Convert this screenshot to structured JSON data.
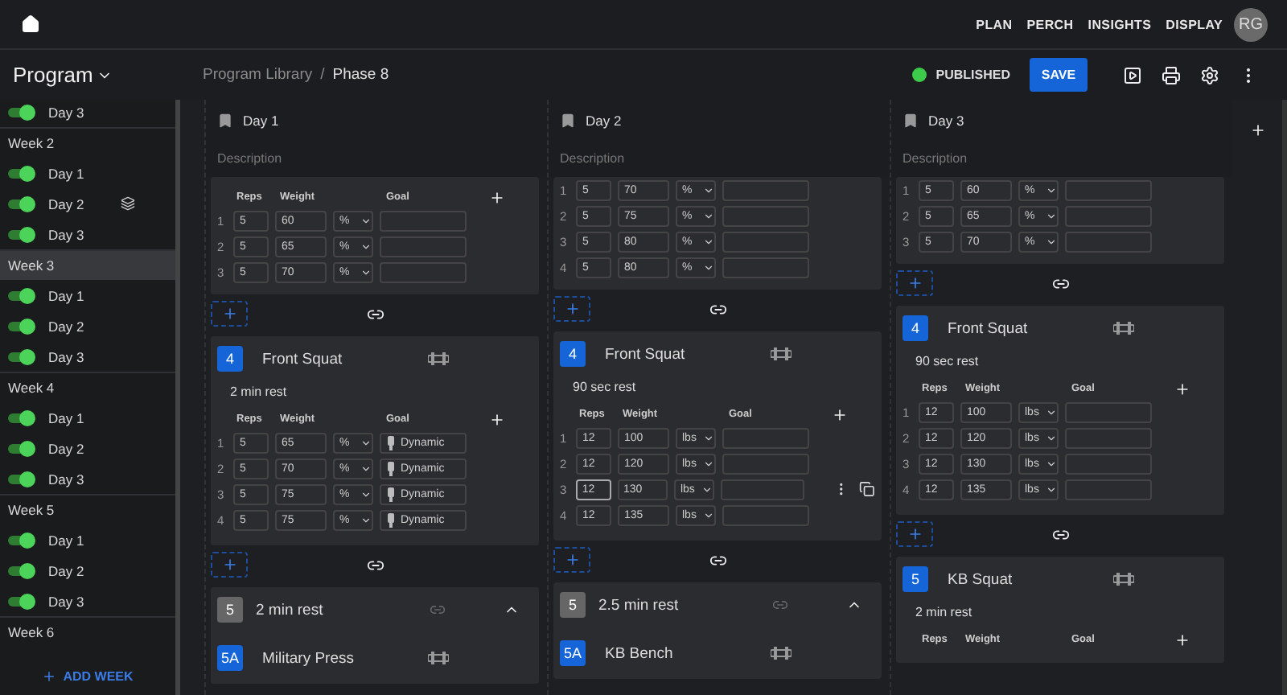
{
  "nav": {
    "links": [
      "PLAN",
      "PERCH",
      "INSIGHTS",
      "DISPLAY"
    ],
    "avatar": "RG"
  },
  "toolbar": {
    "program": "Program",
    "breadcrumb": [
      "Program Library",
      "Phase 8"
    ],
    "separator": "/",
    "status": "PUBLISHED",
    "published": true,
    "save": "SAVE"
  },
  "sidebar": {
    "items": [
      {
        "kind": "day",
        "label": "Day 3",
        "on": true
      },
      {
        "kind": "week",
        "label": "Week 2",
        "selected": false
      },
      {
        "kind": "day",
        "label": "Day 1",
        "on": true
      },
      {
        "kind": "day",
        "label": "Day 2",
        "on": true,
        "layered": true
      },
      {
        "kind": "day",
        "label": "Day 3",
        "on": true
      },
      {
        "kind": "week",
        "label": "Week 3",
        "selected": true
      },
      {
        "kind": "day",
        "label": "Day 1",
        "on": true
      },
      {
        "kind": "day",
        "label": "Day 2",
        "on": true
      },
      {
        "kind": "day",
        "label": "Day 3",
        "on": true
      },
      {
        "kind": "week",
        "label": "Week 4",
        "selected": false
      },
      {
        "kind": "day",
        "label": "Day 1",
        "on": true
      },
      {
        "kind": "day",
        "label": "Day 2",
        "on": true
      },
      {
        "kind": "day",
        "label": "Day 3",
        "on": true
      },
      {
        "kind": "week",
        "label": "Week 5",
        "selected": false
      },
      {
        "kind": "day",
        "label": "Day 1",
        "on": true
      },
      {
        "kind": "day",
        "label": "Day 2",
        "on": true
      },
      {
        "kind": "day",
        "label": "Day 3",
        "on": true
      },
      {
        "kind": "week",
        "label": "Week 6",
        "selected": false
      }
    ],
    "add_week": "ADD WEEK"
  },
  "days": [
    {
      "title": "Day 1",
      "placeholder": "Description",
      "blocks": [
        {
          "kind": "exercise",
          "headers": [
            "Reps",
            "Weight",
            "Goal"
          ],
          "sets": [
            {
              "num": "1",
              "reps": "5",
              "weight": "60",
              "unit": "%"
            },
            {
              "num": "2",
              "reps": "5",
              "weight": "65",
              "unit": "%"
            },
            {
              "num": "3",
              "reps": "5",
              "weight": "70",
              "unit": "%"
            }
          ]
        },
        {
          "kind": "exercise",
          "badge": "4",
          "name": "Front Squat",
          "rest": "2 min rest",
          "headers": [
            "Reps",
            "Weight",
            "Goal"
          ],
          "sets": [
            {
              "num": "1",
              "reps": "5",
              "weight": "65",
              "unit": "%",
              "goal": "Dynamic"
            },
            {
              "num": "2",
              "reps": "5",
              "weight": "70",
              "unit": "%",
              "goal": "Dynamic"
            },
            {
              "num": "3",
              "reps": "5",
              "weight": "75",
              "unit": "%",
              "goal": "Dynamic"
            },
            {
              "num": "4",
              "reps": "5",
              "weight": "75",
              "unit": "%",
              "goal": "Dynamic"
            }
          ]
        },
        {
          "kind": "group",
          "badge": "5",
          "rest": "2 min rest",
          "expanded": true,
          "children": [
            {
              "badge": "5A",
              "name": "Military Press"
            }
          ]
        }
      ]
    },
    {
      "title": "Day 2",
      "placeholder": "Description",
      "blocks": [
        {
          "kind": "exercise",
          "sets": [
            {
              "num": "1",
              "reps": "5",
              "weight": "70",
              "unit": "%"
            },
            {
              "num": "2",
              "reps": "5",
              "weight": "75",
              "unit": "%"
            },
            {
              "num": "3",
              "reps": "5",
              "weight": "80",
              "unit": "%"
            },
            {
              "num": "4",
              "reps": "5",
              "weight": "80",
              "unit": "%"
            }
          ]
        },
        {
          "kind": "exercise",
          "badge": "4",
          "name": "Front Squat",
          "rest": "90 sec rest",
          "headers": [
            "Reps",
            "Weight",
            "Goal"
          ],
          "sets": [
            {
              "num": "1",
              "reps": "12",
              "weight": "100",
              "unit": "lbs"
            },
            {
              "num": "2",
              "reps": "12",
              "weight": "120",
              "unit": "lbs"
            },
            {
              "num": "3",
              "reps": "12",
              "weight": "130",
              "unit": "lbs",
              "focused": true
            },
            {
              "num": "4",
              "reps": "12",
              "weight": "135",
              "unit": "lbs"
            }
          ]
        },
        {
          "kind": "group",
          "badge": "5",
          "rest": "2.5 min rest",
          "expanded": true,
          "children": [
            {
              "badge": "5A",
              "name": "KB Bench"
            }
          ]
        }
      ]
    },
    {
      "title": "Day 3",
      "placeholder": "Description",
      "blocks": [
        {
          "kind": "exercise",
          "sets": [
            {
              "num": "1",
              "reps": "5",
              "weight": "60",
              "unit": "%"
            },
            {
              "num": "2",
              "reps": "5",
              "weight": "65",
              "unit": "%"
            },
            {
              "num": "3",
              "reps": "5",
              "weight": "70",
              "unit": "%"
            }
          ]
        },
        {
          "kind": "exercise",
          "badge": "4",
          "name": "Front Squat",
          "rest": "90 sec rest",
          "headers": [
            "Reps",
            "Weight",
            "Goal"
          ],
          "sets": [
            {
              "num": "1",
              "reps": "12",
              "weight": "100",
              "unit": "lbs"
            },
            {
              "num": "2",
              "reps": "12",
              "weight": "120",
              "unit": "lbs"
            },
            {
              "num": "3",
              "reps": "12",
              "weight": "130",
              "unit": "lbs"
            },
            {
              "num": "4",
              "reps": "12",
              "weight": "135",
              "unit": "lbs"
            }
          ]
        },
        {
          "kind": "exercise",
          "badge": "5",
          "name": "KB Squat",
          "rest": "2 min rest",
          "headers": [
            "Reps",
            "Weight",
            "Goal"
          ]
        }
      ]
    }
  ]
}
